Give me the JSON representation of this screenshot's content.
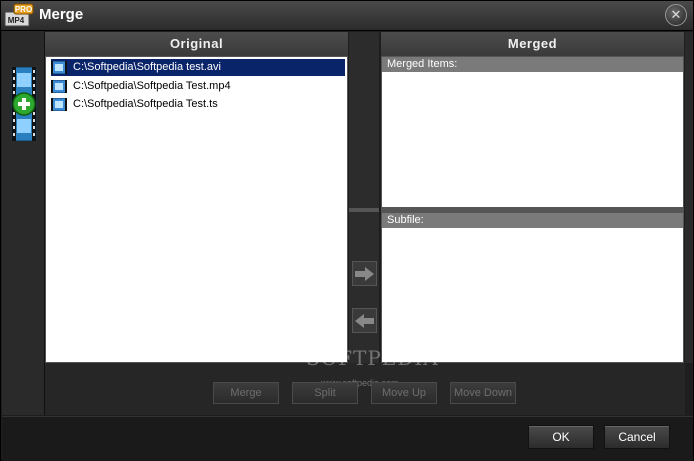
{
  "window": {
    "title": "Merge",
    "logo_badge": "PRO",
    "logo_text": "MP4"
  },
  "original": {
    "header": "Original",
    "files": [
      {
        "path": "C:\\Softpedia\\Softpedia test.avi",
        "selected": true
      },
      {
        "path": "C:\\Softpedia\\Softpedia Test.mp4",
        "selected": false
      },
      {
        "path": "C:\\Softpedia\\Softpedia Test.ts",
        "selected": false
      }
    ]
  },
  "merged": {
    "header": "Merged",
    "merged_items_label": "Merged Items:",
    "subfile_label": "Subfile:"
  },
  "actions": {
    "merge": "Merge",
    "split": "Split",
    "move_up": "Move Up",
    "move_down": "Move Down"
  },
  "watermark": {
    "brand": "SOFTPEDIA",
    "url": "www.softpedia.com"
  },
  "footer": {
    "ok": "OK",
    "cancel": "Cancel"
  },
  "icons": {
    "close": "close-icon",
    "add_file": "add-video-file-icon",
    "arrow_right": "arrow-right-icon",
    "arrow_left": "arrow-left-icon",
    "file": "video-file-icon"
  }
}
